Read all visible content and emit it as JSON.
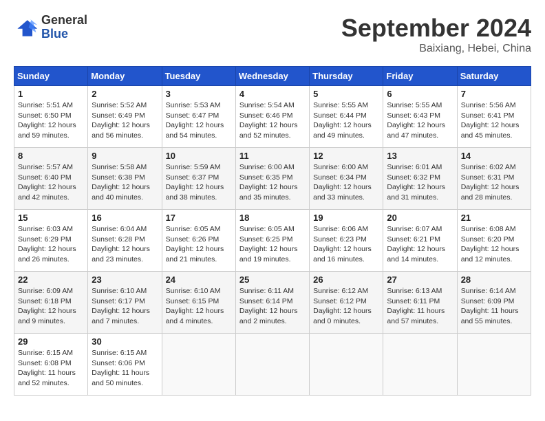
{
  "logo": {
    "general": "General",
    "blue": "Blue"
  },
  "header": {
    "month": "September 2024",
    "location": "Baixiang, Hebei, China"
  },
  "weekdays": [
    "Sunday",
    "Monday",
    "Tuesday",
    "Wednesday",
    "Thursday",
    "Friday",
    "Saturday"
  ],
  "weeks": [
    [
      {
        "day": "1",
        "sunrise": "Sunrise: 5:51 AM",
        "sunset": "Sunset: 6:50 PM",
        "daylight": "Daylight: 12 hours and 59 minutes."
      },
      {
        "day": "2",
        "sunrise": "Sunrise: 5:52 AM",
        "sunset": "Sunset: 6:49 PM",
        "daylight": "Daylight: 12 hours and 56 minutes."
      },
      {
        "day": "3",
        "sunrise": "Sunrise: 5:53 AM",
        "sunset": "Sunset: 6:47 PM",
        "daylight": "Daylight: 12 hours and 54 minutes."
      },
      {
        "day": "4",
        "sunrise": "Sunrise: 5:54 AM",
        "sunset": "Sunset: 6:46 PM",
        "daylight": "Daylight: 12 hours and 52 minutes."
      },
      {
        "day": "5",
        "sunrise": "Sunrise: 5:55 AM",
        "sunset": "Sunset: 6:44 PM",
        "daylight": "Daylight: 12 hours and 49 minutes."
      },
      {
        "day": "6",
        "sunrise": "Sunrise: 5:55 AM",
        "sunset": "Sunset: 6:43 PM",
        "daylight": "Daylight: 12 hours and 47 minutes."
      },
      {
        "day": "7",
        "sunrise": "Sunrise: 5:56 AM",
        "sunset": "Sunset: 6:41 PM",
        "daylight": "Daylight: 12 hours and 45 minutes."
      }
    ],
    [
      {
        "day": "8",
        "sunrise": "Sunrise: 5:57 AM",
        "sunset": "Sunset: 6:40 PM",
        "daylight": "Daylight: 12 hours and 42 minutes."
      },
      {
        "day": "9",
        "sunrise": "Sunrise: 5:58 AM",
        "sunset": "Sunset: 6:38 PM",
        "daylight": "Daylight: 12 hours and 40 minutes."
      },
      {
        "day": "10",
        "sunrise": "Sunrise: 5:59 AM",
        "sunset": "Sunset: 6:37 PM",
        "daylight": "Daylight: 12 hours and 38 minutes."
      },
      {
        "day": "11",
        "sunrise": "Sunrise: 6:00 AM",
        "sunset": "Sunset: 6:35 PM",
        "daylight": "Daylight: 12 hours and 35 minutes."
      },
      {
        "day": "12",
        "sunrise": "Sunrise: 6:00 AM",
        "sunset": "Sunset: 6:34 PM",
        "daylight": "Daylight: 12 hours and 33 minutes."
      },
      {
        "day": "13",
        "sunrise": "Sunrise: 6:01 AM",
        "sunset": "Sunset: 6:32 PM",
        "daylight": "Daylight: 12 hours and 31 minutes."
      },
      {
        "day": "14",
        "sunrise": "Sunrise: 6:02 AM",
        "sunset": "Sunset: 6:31 PM",
        "daylight": "Daylight: 12 hours and 28 minutes."
      }
    ],
    [
      {
        "day": "15",
        "sunrise": "Sunrise: 6:03 AM",
        "sunset": "Sunset: 6:29 PM",
        "daylight": "Daylight: 12 hours and 26 minutes."
      },
      {
        "day": "16",
        "sunrise": "Sunrise: 6:04 AM",
        "sunset": "Sunset: 6:28 PM",
        "daylight": "Daylight: 12 hours and 23 minutes."
      },
      {
        "day": "17",
        "sunrise": "Sunrise: 6:05 AM",
        "sunset": "Sunset: 6:26 PM",
        "daylight": "Daylight: 12 hours and 21 minutes."
      },
      {
        "day": "18",
        "sunrise": "Sunrise: 6:05 AM",
        "sunset": "Sunset: 6:25 PM",
        "daylight": "Daylight: 12 hours and 19 minutes."
      },
      {
        "day": "19",
        "sunrise": "Sunrise: 6:06 AM",
        "sunset": "Sunset: 6:23 PM",
        "daylight": "Daylight: 12 hours and 16 minutes."
      },
      {
        "day": "20",
        "sunrise": "Sunrise: 6:07 AM",
        "sunset": "Sunset: 6:21 PM",
        "daylight": "Daylight: 12 hours and 14 minutes."
      },
      {
        "day": "21",
        "sunrise": "Sunrise: 6:08 AM",
        "sunset": "Sunset: 6:20 PM",
        "daylight": "Daylight: 12 hours and 12 minutes."
      }
    ],
    [
      {
        "day": "22",
        "sunrise": "Sunrise: 6:09 AM",
        "sunset": "Sunset: 6:18 PM",
        "daylight": "Daylight: 12 hours and 9 minutes."
      },
      {
        "day": "23",
        "sunrise": "Sunrise: 6:10 AM",
        "sunset": "Sunset: 6:17 PM",
        "daylight": "Daylight: 12 hours and 7 minutes."
      },
      {
        "day": "24",
        "sunrise": "Sunrise: 6:10 AM",
        "sunset": "Sunset: 6:15 PM",
        "daylight": "Daylight: 12 hours and 4 minutes."
      },
      {
        "day": "25",
        "sunrise": "Sunrise: 6:11 AM",
        "sunset": "Sunset: 6:14 PM",
        "daylight": "Daylight: 12 hours and 2 minutes."
      },
      {
        "day": "26",
        "sunrise": "Sunrise: 6:12 AM",
        "sunset": "Sunset: 6:12 PM",
        "daylight": "Daylight: 12 hours and 0 minutes."
      },
      {
        "day": "27",
        "sunrise": "Sunrise: 6:13 AM",
        "sunset": "Sunset: 6:11 PM",
        "daylight": "Daylight: 11 hours and 57 minutes."
      },
      {
        "day": "28",
        "sunrise": "Sunrise: 6:14 AM",
        "sunset": "Sunset: 6:09 PM",
        "daylight": "Daylight: 11 hours and 55 minutes."
      }
    ],
    [
      {
        "day": "29",
        "sunrise": "Sunrise: 6:15 AM",
        "sunset": "Sunset: 6:08 PM",
        "daylight": "Daylight: 11 hours and 52 minutes."
      },
      {
        "day": "30",
        "sunrise": "Sunrise: 6:15 AM",
        "sunset": "Sunset: 6:06 PM",
        "daylight": "Daylight: 11 hours and 50 minutes."
      },
      null,
      null,
      null,
      null,
      null
    ]
  ]
}
